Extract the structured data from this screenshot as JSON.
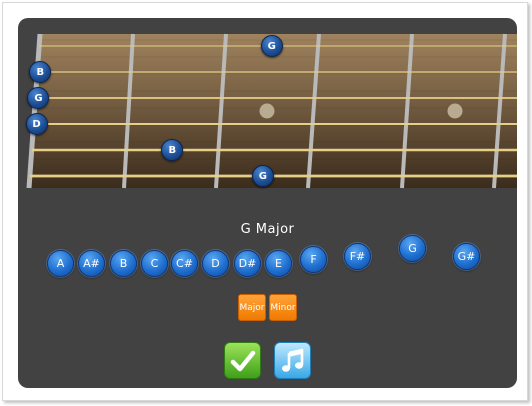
{
  "fretboard": {
    "string_count": 6,
    "visible_frets": 5,
    "colors": {
      "wood_light": "#a0835e",
      "wood_dark": "#3b2c1c",
      "string": "#e6cf8a",
      "fret": "#b9b9b9"
    },
    "notes": [
      {
        "label": "G",
        "string": 1,
        "fret": 3
      },
      {
        "label": "B",
        "string": 2,
        "fret": 0
      },
      {
        "label": "G",
        "string": 3,
        "fret": 0
      },
      {
        "label": "D",
        "string": 4,
        "fret": 0
      },
      {
        "label": "B",
        "string": 5,
        "fret": 2
      },
      {
        "label": "G",
        "string": 6,
        "fret": 3
      }
    ]
  },
  "chord": {
    "name": "G Major"
  },
  "note_buttons": [
    "A",
    "A#",
    "B",
    "C",
    "C#",
    "D",
    "D#",
    "E",
    "F",
    "F#",
    "G",
    "G#"
  ],
  "chord_types": {
    "major": "Major",
    "minor": "Minor"
  },
  "actions": {
    "check_icon": "checkmark-icon",
    "play_icon": "music-note-icon"
  }
}
